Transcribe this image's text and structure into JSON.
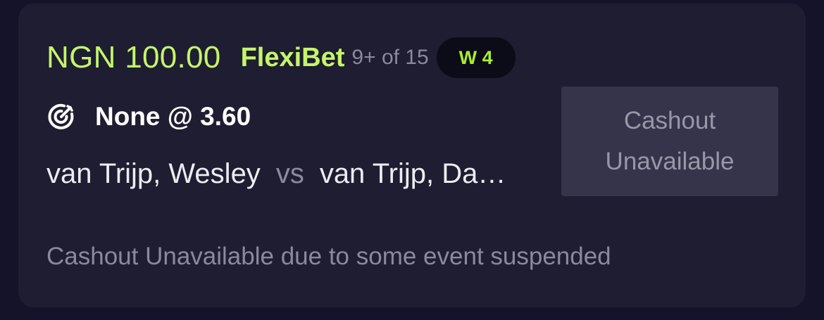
{
  "bet": {
    "amount": "NGN 100.00",
    "type": "FlexiBet",
    "legs": "9+ of 15",
    "badge": "W 4"
  },
  "selection": {
    "icon": "target-icon",
    "pick": "None @ 3.60"
  },
  "match": {
    "home": "van Trijp, Wesley",
    "vs": "vs",
    "away": "van Trijp, Da…"
  },
  "cashout": {
    "label": "Cashout Unavailable"
  },
  "note": "Cashout Unavailable due to some event suspended",
  "colors": {
    "background": "#15132a",
    "card": "#1e1d31",
    "accent": "#c5f56a",
    "badge_text": "#a8ee2c",
    "muted": "#8b8a9c",
    "button_bg": "#35344a"
  }
}
